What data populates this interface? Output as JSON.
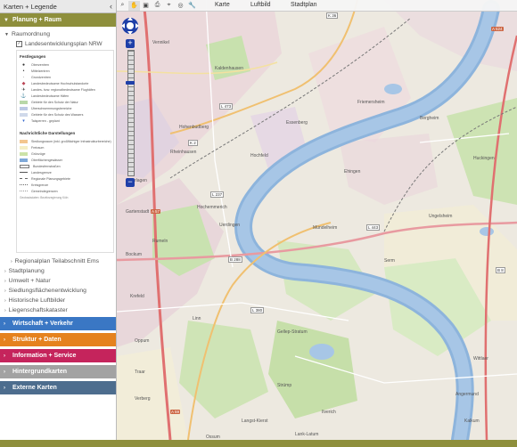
{
  "sidebar": {
    "title": "Karten + Legende",
    "collapse_icon": "chevron-left-icon",
    "categories": {
      "planung": "Planung + Raum",
      "wirtschaft": "Wirtschaft + Verkehr",
      "struktur": "Struktur + Daten",
      "information": "Information + Service",
      "hintergrund": "Hintergrundkarten",
      "extern": "Externe Karten"
    },
    "raumordnung": "Raumordnung",
    "layer": "Landesentwicklungsplan NRW",
    "legend": {
      "festlegungen": "Festlegungen",
      "items": [
        "Oberzentren",
        "Mittelzentren",
        "Grundzentren",
        "Landesbedeutsame Hochschulstandorte",
        "Landes- bzw. regionalbedeutsame Flughäfen",
        "Landesbedeutsame Häfen",
        "Gebiete für den Schutz der Natur",
        "Überschwemmungsbereiche",
        "Gebiete für den Schutz des Wassers",
        "Talsperren - geplant"
      ],
      "nachrichtlich": "Nachrichtliche Darstellungen",
      "items2": [
        "Siedlungsraum (inkl. großflächiger Infrastrukturbereiche)",
        "Freiraum",
        "Grünzüge",
        "Oberflächengewässer",
        "Bundesfernstraßen",
        "Landesgrenze",
        "Regionale Planungsgebiete",
        "Kreisgrenze",
        "Gemeindegrenzen",
        "Geobasisdaten: Bezirksregierung Köln"
      ]
    },
    "tree_items": [
      "Regionalplan Teilabschnitt Ems",
      "Stadtplanung",
      "Umwelt + Natur",
      "Siedlungsflächenentwicklung",
      "Historische Luftbilder",
      "Liegenschaftskataster"
    ]
  },
  "toolbar": {
    "tabs": [
      "Karte",
      "Luftbild",
      "Stadtplan"
    ]
  },
  "map": {
    "places": [
      "Vennikel",
      "Kaldenhausen",
      "Essenberg",
      "Hochfeld",
      "Rheinhausen",
      "Friemersheim",
      "Bergheim",
      "Ehingen",
      "Hochemmerich",
      "Uerdingen",
      "Linn",
      "Lank-Latum",
      "Strümp",
      "Gellep-Stratum",
      "Ossum",
      "Kalkum",
      "Angermund",
      "Wittlaer",
      "Mündelheim",
      "Serm",
      "Huckingen",
      "Ungelsheim",
      "Rumeln",
      "Asterlagen",
      "Bockum",
      "Krefeld",
      "Langst-Kierst",
      "Ilverich",
      "Hohenbudberg",
      "Traar",
      "Verberg",
      "Gartenstadt",
      "Oppum"
    ],
    "roads": [
      "K 36",
      "A 57",
      "B 288",
      "L 473",
      "L 237",
      "A 524",
      "L 380",
      "K 2",
      "A 59",
      "B 8",
      "L 443"
    ]
  },
  "colors": {
    "planung": "#8e8f3c",
    "wirtschaft": "#3a77c4",
    "struktur": "#e5821e",
    "information": "#c5245c",
    "hintergrund": "#a2a2a2",
    "extern": "#4d6d8e",
    "river": "#7fa9d8"
  }
}
